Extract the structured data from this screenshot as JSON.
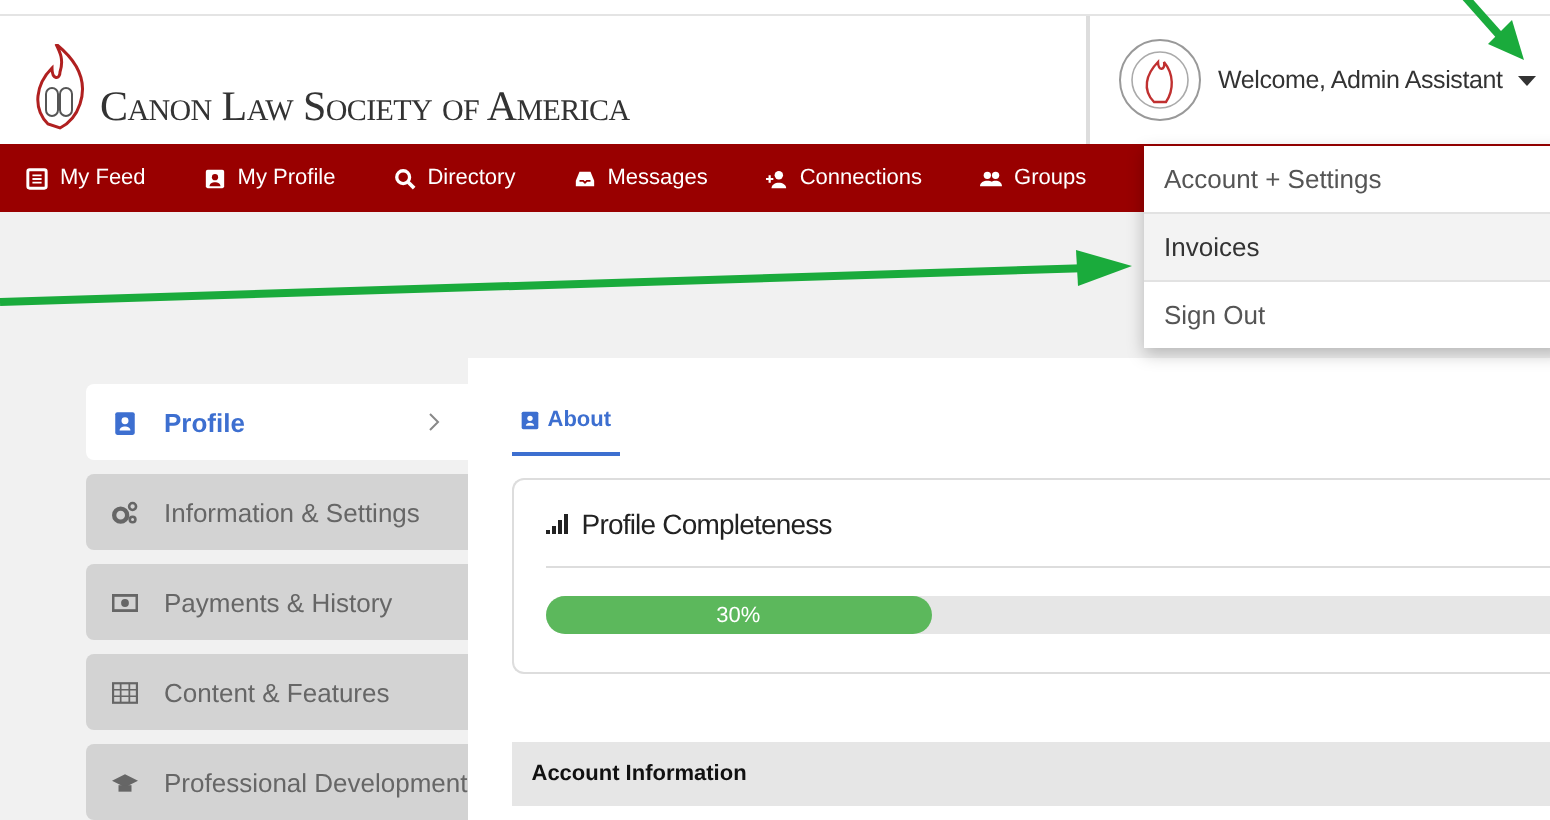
{
  "header": {
    "logo_text": "Canon Law Society of America",
    "user_greeting": "Welcome, Admin Assistant"
  },
  "nav": [
    {
      "label": "My Feed"
    },
    {
      "label": "My Profile"
    },
    {
      "label": "Directory"
    },
    {
      "label": "Messages"
    },
    {
      "label": "Connections"
    },
    {
      "label": "Groups"
    }
  ],
  "user_menu": [
    {
      "label": "Account + Settings",
      "selected": false
    },
    {
      "label": "Invoices",
      "selected": true
    },
    {
      "label": "Sign Out",
      "selected": false
    }
  ],
  "sidebar": {
    "items": [
      {
        "label": "Profile",
        "selected": true
      },
      {
        "label": "Information & Settings",
        "selected": false
      },
      {
        "label": "Payments & History",
        "selected": false
      },
      {
        "label": "Content & Features",
        "selected": false
      },
      {
        "label": "Professional Development",
        "selected": false
      }
    ]
  },
  "tabs": [
    {
      "label": "About",
      "selected": true
    }
  ],
  "profile_completeness": {
    "title": "Profile Completeness",
    "level": 0.3,
    "reading": "30%"
  },
  "account_section": {
    "title": "Account Information"
  }
}
